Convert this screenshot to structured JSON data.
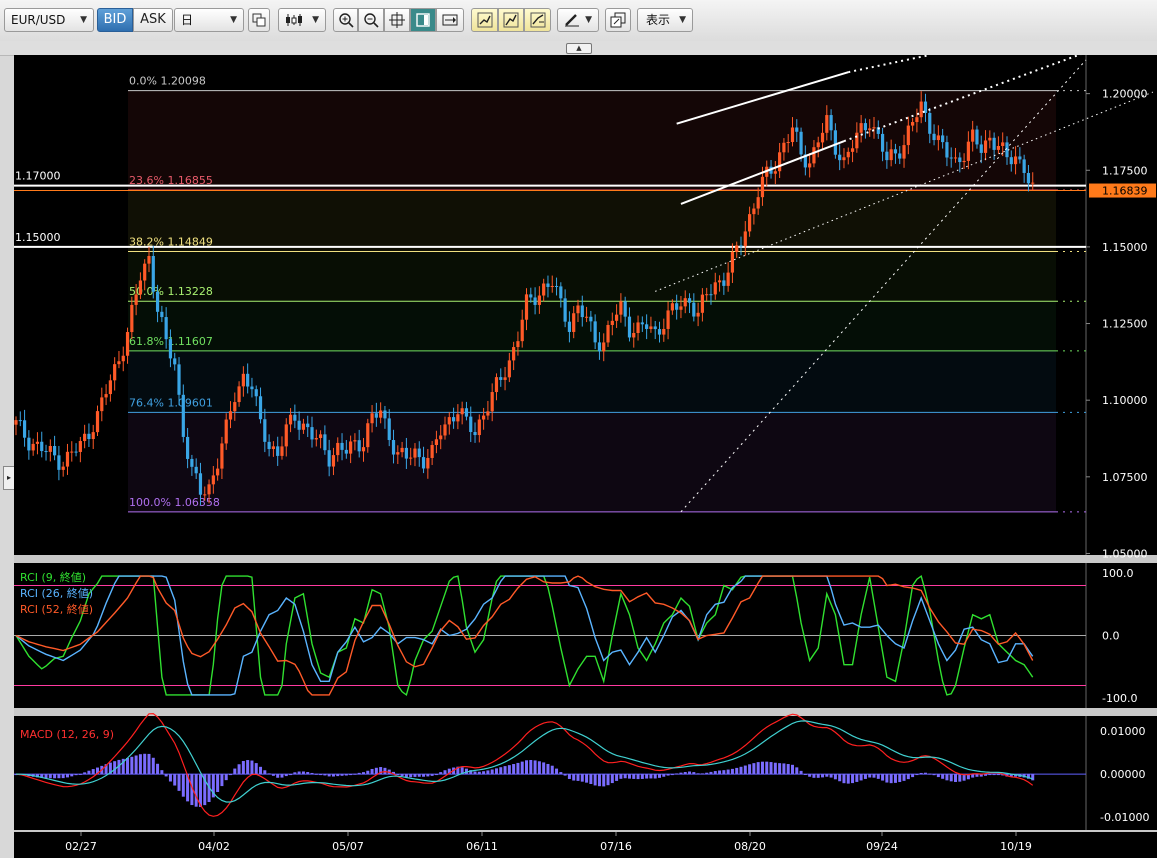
{
  "toolbar": {
    "symbol": "EUR/USD",
    "bid_label": "BID",
    "ask_label": "ASK",
    "period": "日",
    "display_label": "表示",
    "icons": [
      "copy-icon",
      "candlestick-type-icon",
      "zoom-in-icon",
      "zoom-out-icon",
      "fit-icon",
      "window-icon",
      "scroll-end-icon",
      "trendline-icon",
      "channel-icon",
      "fibonacci-icon",
      "pen-icon",
      "export-icon"
    ]
  },
  "chart_data": {
    "type": "candlestick",
    "price_axis": {
      "ticks": [
        "1.20000",
        "1.17500",
        "1.15000",
        "1.12500",
        "1.10000",
        "1.07500",
        "1.05000"
      ],
      "min": 1.0495,
      "max": 1.2126
    },
    "current_price": "1.16839",
    "date_ticks": [
      "02/27",
      "04/02",
      "05/07",
      "06/11",
      "07/16",
      "08/20",
      "09/24",
      "10/19"
    ],
    "horizontal_lines": [
      {
        "label": "1.17000",
        "value": 1.17
      },
      {
        "label": "1.15000",
        "value": 1.15
      }
    ],
    "fibonacci": [
      {
        "ratio": "0.0%",
        "value": "1.20098",
        "color": "#c8c8c8"
      },
      {
        "ratio": "23.6%",
        "value": "1.16855",
        "color": "#e85a6a"
      },
      {
        "ratio": "38.2%",
        "value": "1.14849",
        "color": "#f0e080"
      },
      {
        "ratio": "50.0%",
        "value": "1.13228",
        "color": "#a8f070"
      },
      {
        "ratio": "61.8%",
        "value": "1.11607",
        "color": "#70e060"
      },
      {
        "ratio": "76.4%",
        "value": "1.09601",
        "color": "#40a0e0"
      },
      {
        "ratio": "100.0%",
        "value": "1.06358",
        "color": "#b070f0"
      }
    ],
    "close_path": [
      [
        0,
        1.092
      ],
      [
        3,
        1.087
      ],
      [
        7,
        1.083
      ],
      [
        11,
        1.08
      ],
      [
        15,
        1.085
      ],
      [
        19,
        1.095
      ],
      [
        23,
        1.11
      ],
      [
        26,
        1.122
      ],
      [
        29,
        1.14
      ],
      [
        31,
        1.147
      ],
      [
        33,
        1.13
      ],
      [
        35,
        1.118
      ],
      [
        37,
        1.112
      ],
      [
        39,
        1.09
      ],
      [
        41,
        1.076
      ],
      [
        43,
        1.07
      ],
      [
        45,
        1.072
      ],
      [
        47,
        1.08
      ],
      [
        49,
        1.09
      ],
      [
        51,
        1.102
      ],
      [
        53,
        1.108
      ],
      [
        55,
        1.104
      ],
      [
        57,
        1.092
      ],
      [
        59,
        1.086
      ],
      [
        61,
        1.082
      ],
      [
        63,
        1.09
      ],
      [
        65,
        1.095
      ],
      [
        67,
        1.092
      ],
      [
        69,
        1.088
      ],
      [
        71,
        1.086
      ],
      [
        73,
        1.082
      ],
      [
        75,
        1.084
      ],
      [
        77,
        1.083
      ],
      [
        79,
        1.086
      ],
      [
        81,
        1.087
      ],
      [
        83,
        1.094
      ],
      [
        85,
        1.096
      ],
      [
        87,
        1.089
      ],
      [
        89,
        1.082
      ],
      [
        91,
        1.081
      ],
      [
        93,
        1.083
      ],
      [
        95,
        1.081
      ],
      [
        97,
        1.082
      ],
      [
        99,
        1.09
      ],
      [
        101,
        1.094
      ],
      [
        103,
        1.097
      ],
      [
        105,
        1.092
      ],
      [
        107,
        1.09
      ],
      [
        109,
        1.096
      ],
      [
        111,
        1.101
      ],
      [
        113,
        1.107
      ],
      [
        115,
        1.113
      ],
      [
        117,
        1.121
      ],
      [
        119,
        1.131
      ],
      [
        121,
        1.134
      ],
      [
        123,
        1.137
      ],
      [
        125,
        1.138
      ],
      [
        127,
        1.131
      ],
      [
        129,
        1.125
      ],
      [
        131,
        1.13
      ],
      [
        133,
        1.126
      ],
      [
        135,
        1.12
      ],
      [
        137,
        1.119
      ],
      [
        139,
        1.126
      ],
      [
        141,
        1.13
      ],
      [
        143,
        1.124
      ],
      [
        145,
        1.123
      ],
      [
        147,
        1.124
      ],
      [
        149,
        1.122
      ],
      [
        151,
        1.126
      ],
      [
        153,
        1.129
      ],
      [
        155,
        1.131
      ],
      [
        157,
        1.133
      ],
      [
        159,
        1.128
      ],
      [
        161,
        1.134
      ],
      [
        163,
        1.138
      ],
      [
        165,
        1.14
      ],
      [
        167,
        1.145
      ],
      [
        169,
        1.152
      ],
      [
        171,
        1.16
      ],
      [
        173,
        1.168
      ],
      [
        175,
        1.173
      ],
      [
        177,
        1.177
      ],
      [
        179,
        1.184
      ],
      [
        181,
        1.188
      ],
      [
        183,
        1.18
      ],
      [
        185,
        1.178
      ],
      [
        187,
        1.185
      ],
      [
        189,
        1.19
      ],
      [
        191,
        1.183
      ],
      [
        193,
        1.178
      ],
      [
        195,
        1.183
      ],
      [
        197,
        1.188
      ],
      [
        199,
        1.192
      ],
      [
        201,
        1.185
      ],
      [
        203,
        1.178
      ],
      [
        205,
        1.181
      ],
      [
        207,
        1.184
      ],
      [
        209,
        1.19
      ],
      [
        211,
        1.196
      ],
      [
        213,
        1.19
      ],
      [
        215,
        1.184
      ],
      [
        217,
        1.18
      ],
      [
        219,
        1.178
      ],
      [
        221,
        1.181
      ],
      [
        223,
        1.185
      ],
      [
        225,
        1.182
      ],
      [
        227,
        1.186
      ],
      [
        229,
        1.183
      ],
      [
        231,
        1.178
      ],
      [
        233,
        1.18
      ],
      [
        235,
        1.176
      ],
      [
        237,
        1.168
      ]
    ],
    "indicators": {
      "rci": {
        "labels": [
          "RCI (9, 終値)",
          "RCI (26, 終値)",
          "RCI (52, 終値)"
        ],
        "colors": [
          "#30e030",
          "#5ab4ff",
          "#ff5a28"
        ],
        "axis": [
          "100.0",
          "0.0",
          "-100.0"
        ]
      },
      "macd": {
        "label": "MACD (12, 26, 9)",
        "axis": [
          "0.01000",
          "0.00000",
          "-0.01000"
        ]
      }
    }
  }
}
